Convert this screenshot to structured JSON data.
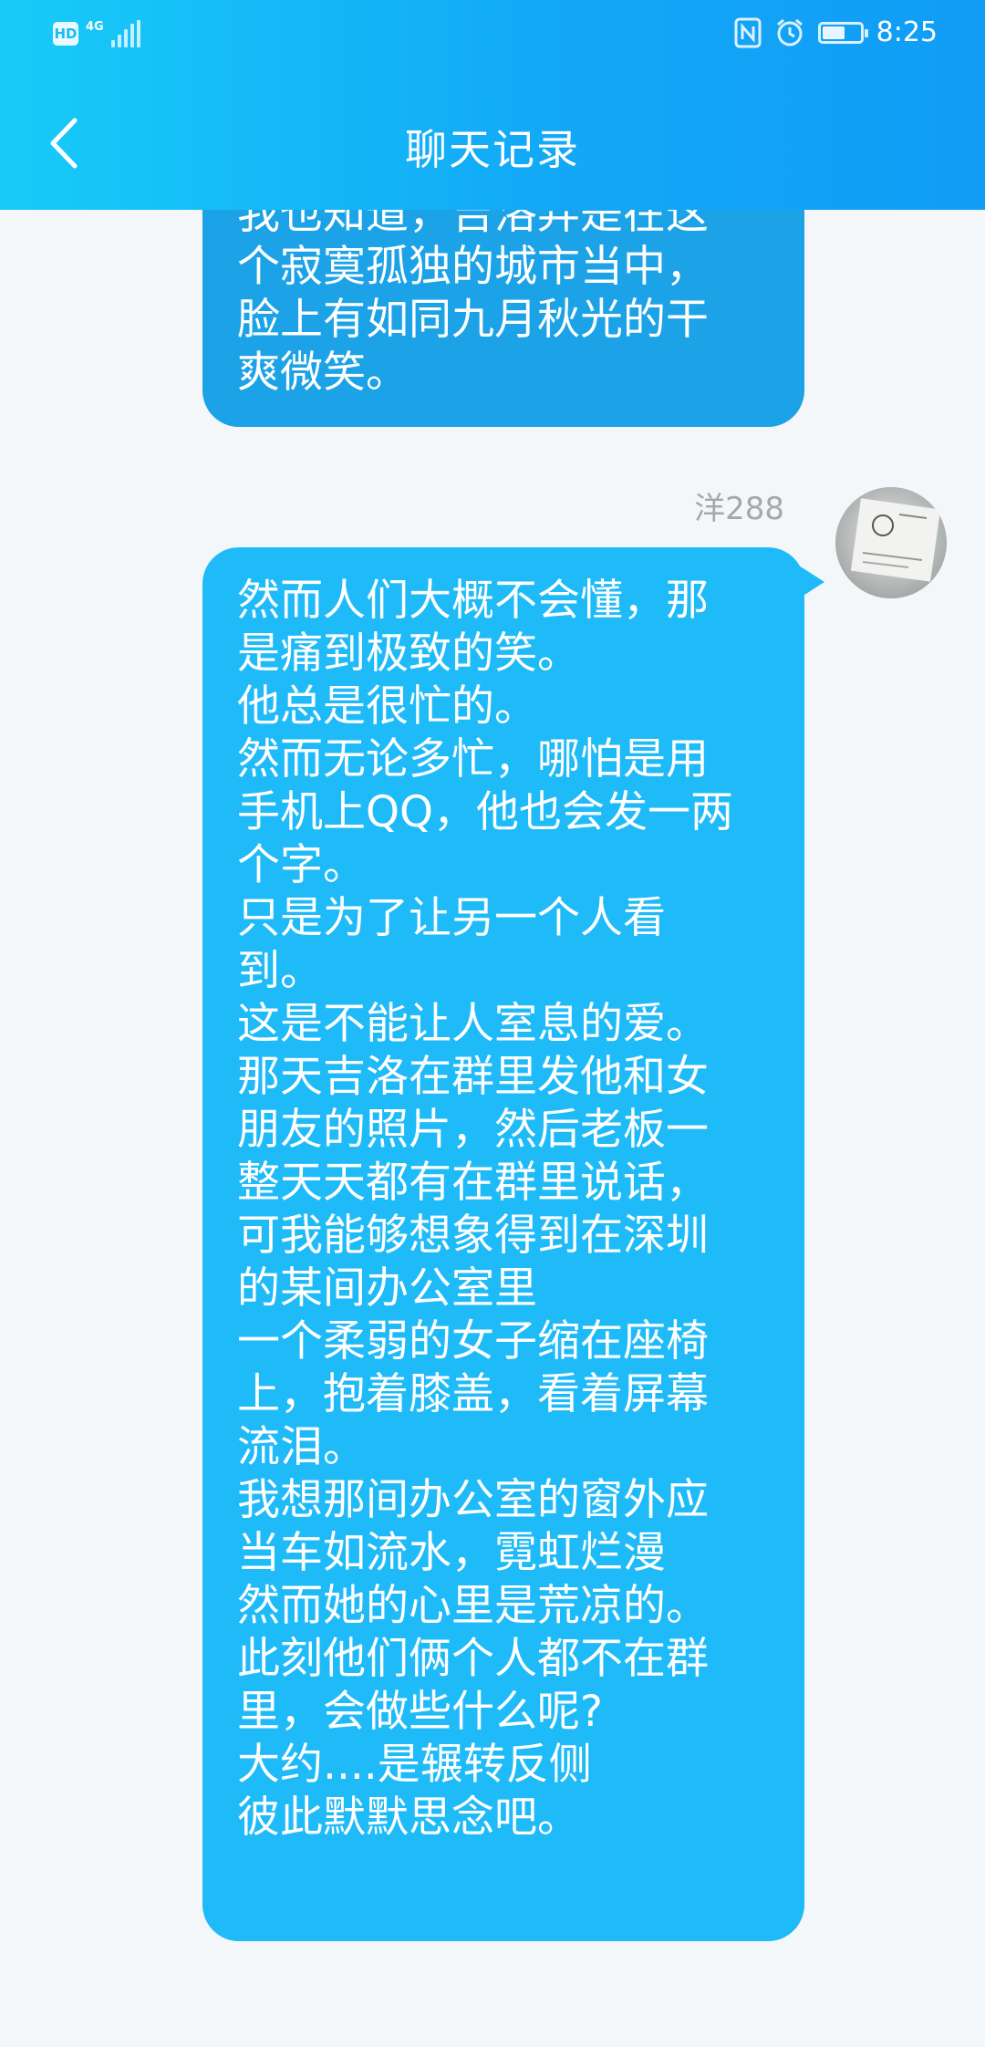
{
  "status_bar": {
    "hd_label": "HD",
    "network_label": "4G",
    "time": "8:25",
    "icons": [
      "nfc-icon",
      "alarm-icon",
      "battery-icon"
    ],
    "battery_level_percent": 60
  },
  "nav": {
    "back_icon": "chevron-left-icon",
    "title": "聊天记录"
  },
  "colors": {
    "header_start": "#18cbf8",
    "header_end": "#119cf6",
    "bubble_main": "#1fbaf8",
    "bubble_prev": "#1ca2e6",
    "page_bg": "#f4f7fa"
  },
  "messages": [
    {
      "text": "我也知道，吉洛弄是在这\n个寂寞孤独的城市当中，\n脸上有如同九月秋光的干\n爽微笑。"
    },
    {
      "sender": "洋288",
      "text": "然而人们大概不会懂，那\n是痛到极致的笑。\n他总是很忙的。\n然而无论多忙，哪怕是用\n手机上QQ，他也会发一两\n个字。\n只是为了让另一个人看\n到。\n这是不能让人室息的爱。\n那天吉洛在群里发他和女\n朋友的照片，然后老板一\n整天天都有在群里说话，\n可我能够想象得到在深圳\n的某间办公室里\n一个柔弱的女子缩在座椅\n上，抱着膝盖，看着屏幕\n流泪。\n我想那间办公室的窗外应\n当车如流水，霓虹烂漫\n然而她的心里是荒凉的。\n此刻他们俩个人都不在群\n里，会做些什么呢?\n大约....是辗转反侧\n彼此默默思念吧。"
    }
  ]
}
